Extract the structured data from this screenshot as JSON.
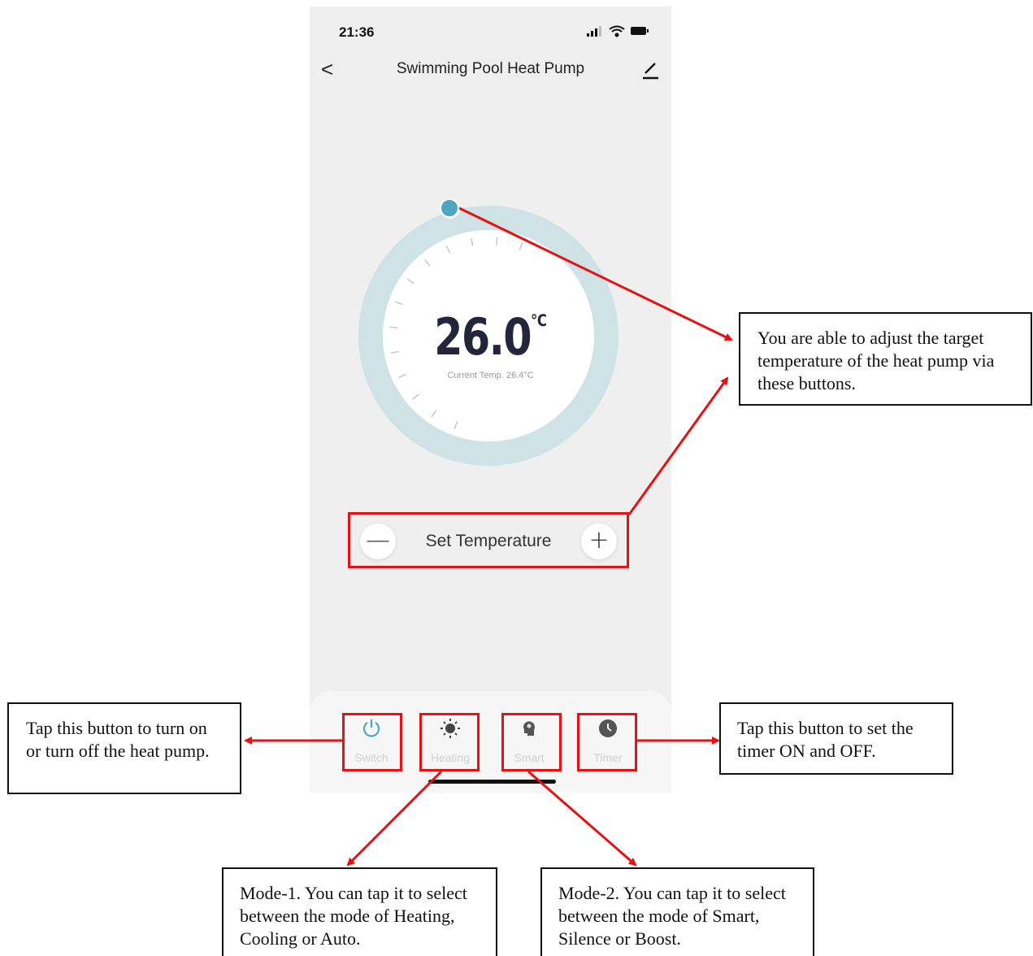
{
  "status_bar": {
    "time": "21:36"
  },
  "nav": {
    "back_glyph": "<",
    "title": "Swimming Pool Heat Pump",
    "edit_icon": "pencil-icon"
  },
  "thermostat": {
    "target_value": "26.0",
    "unit": "℃",
    "current_temp": "Current Temp. 26.4°C",
    "accent_color": "#4ba8c0"
  },
  "set_temperature": {
    "minus": "—",
    "label": "Set Temperature",
    "plus": "+"
  },
  "tabs": [
    {
      "label": "Switch",
      "icon": "power-icon"
    },
    {
      "label": "Heating",
      "icon": "sun-icon"
    },
    {
      "label": "Smart",
      "icon": "head-icon"
    },
    {
      "label": "Timer",
      "icon": "clock-icon"
    }
  ],
  "callouts": {
    "target_temp": "You are able to adjust the target temperature of the heat pump via these buttons.",
    "switch": "Tap this button to turn on or turn off the heat pump.",
    "timer": "Tap this button to set the timer ON and OFF.",
    "mode1": "Mode-1. You can tap it to select between the mode of Heating, Cooling or Auto.",
    "mode2": "Mode-2. You can tap it to select between the mode of Smart, Silence or Boost."
  },
  "colors": {
    "highlight_red": "#e81010",
    "background": "#efefef"
  }
}
